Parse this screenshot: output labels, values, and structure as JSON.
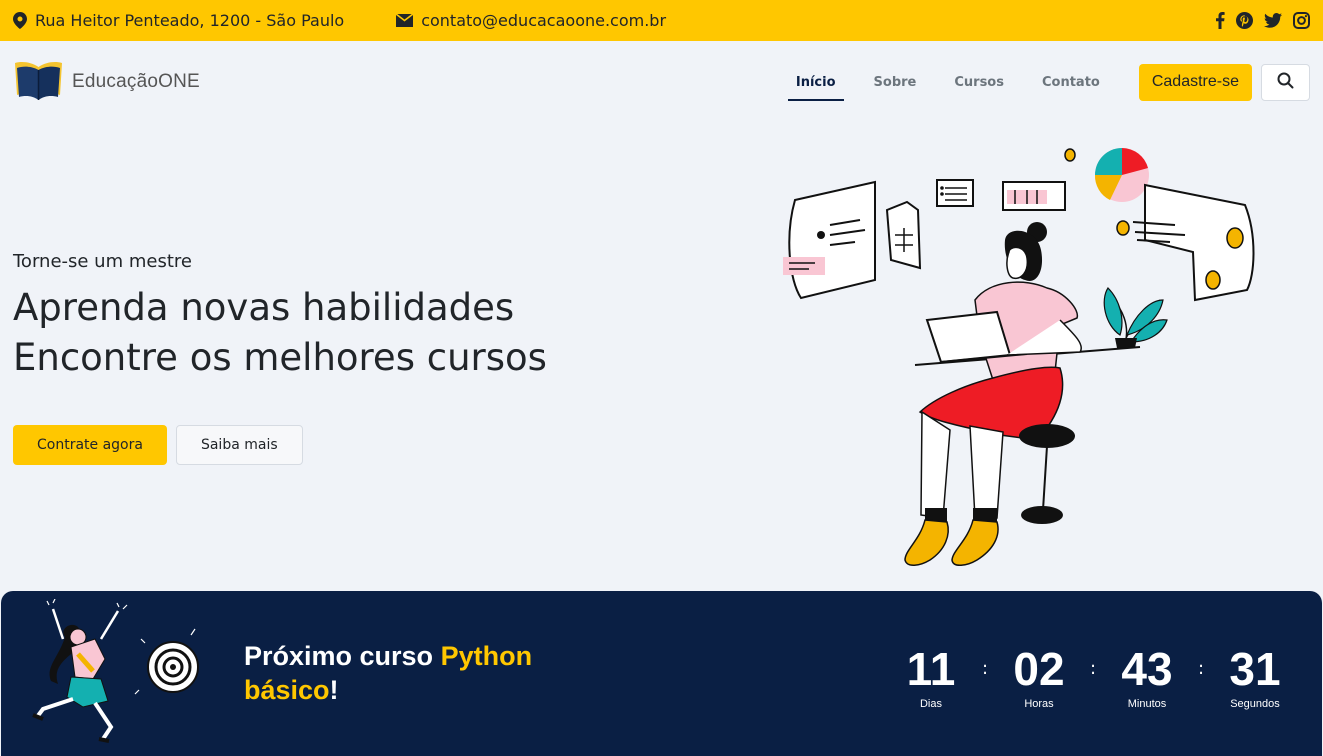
{
  "topbar": {
    "address": "Rua Heitor Penteado, 1200 - São Paulo",
    "email": "contato@educacaoone.com.br",
    "socials": [
      "facebook-icon",
      "pinterest-icon",
      "twitter-icon",
      "instagram-icon"
    ]
  },
  "brand": {
    "name": "EducaçãoONE",
    "logo_icon": "open-book-icon"
  },
  "nav": {
    "items": [
      {
        "label": "Início",
        "active": true
      },
      {
        "label": "Sobre",
        "active": false
      },
      {
        "label": "Cursos",
        "active": false
      },
      {
        "label": "Contato",
        "active": false
      }
    ],
    "cta_label": "Cadastre-se",
    "search_icon": "search-icon"
  },
  "hero": {
    "subtitle": "Torne-se um mestre",
    "title_line1": "Aprenda novas habilidades",
    "title_line2": "Encontre os melhores cursos",
    "primary_button": "Contrate agora",
    "secondary_button": "Saiba mais"
  },
  "banner": {
    "text_prefix": "Próximo curso ",
    "text_highlight_1": "Python",
    "text_highlight_2": "básico",
    "text_suffix": "!",
    "countdown": [
      {
        "value": "11",
        "label": "Dias"
      },
      {
        "value": "02",
        "label": "Horas"
      },
      {
        "value": "43",
        "label": "Minutos"
      },
      {
        "value": "31",
        "label": "Segundos"
      }
    ],
    "separator": ":"
  },
  "colors": {
    "accent": "#ffc700",
    "navy": "#0a1f44",
    "background": "#f0f3f8"
  }
}
